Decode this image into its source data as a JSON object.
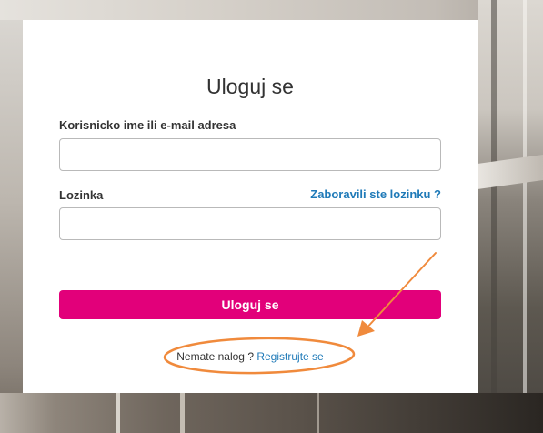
{
  "login": {
    "title": "Uloguj se",
    "username_label": "Korisnicko ime ili e-mail adresa",
    "username_value": "",
    "password_label": "Lozinka",
    "password_value": "",
    "forgot_link": "Zaboravili ste lozinku ?",
    "submit_label": "Uloguj se",
    "no_account_text": "Nemate nalog ?",
    "register_link": "Registrujte se"
  },
  "colors": {
    "accent": "#e2007a",
    "link": "#1f7ab8",
    "annotation": "#f08a3c"
  },
  "annotation": {
    "shapes": [
      "arrow-icon",
      "ellipse-highlight"
    ]
  }
}
